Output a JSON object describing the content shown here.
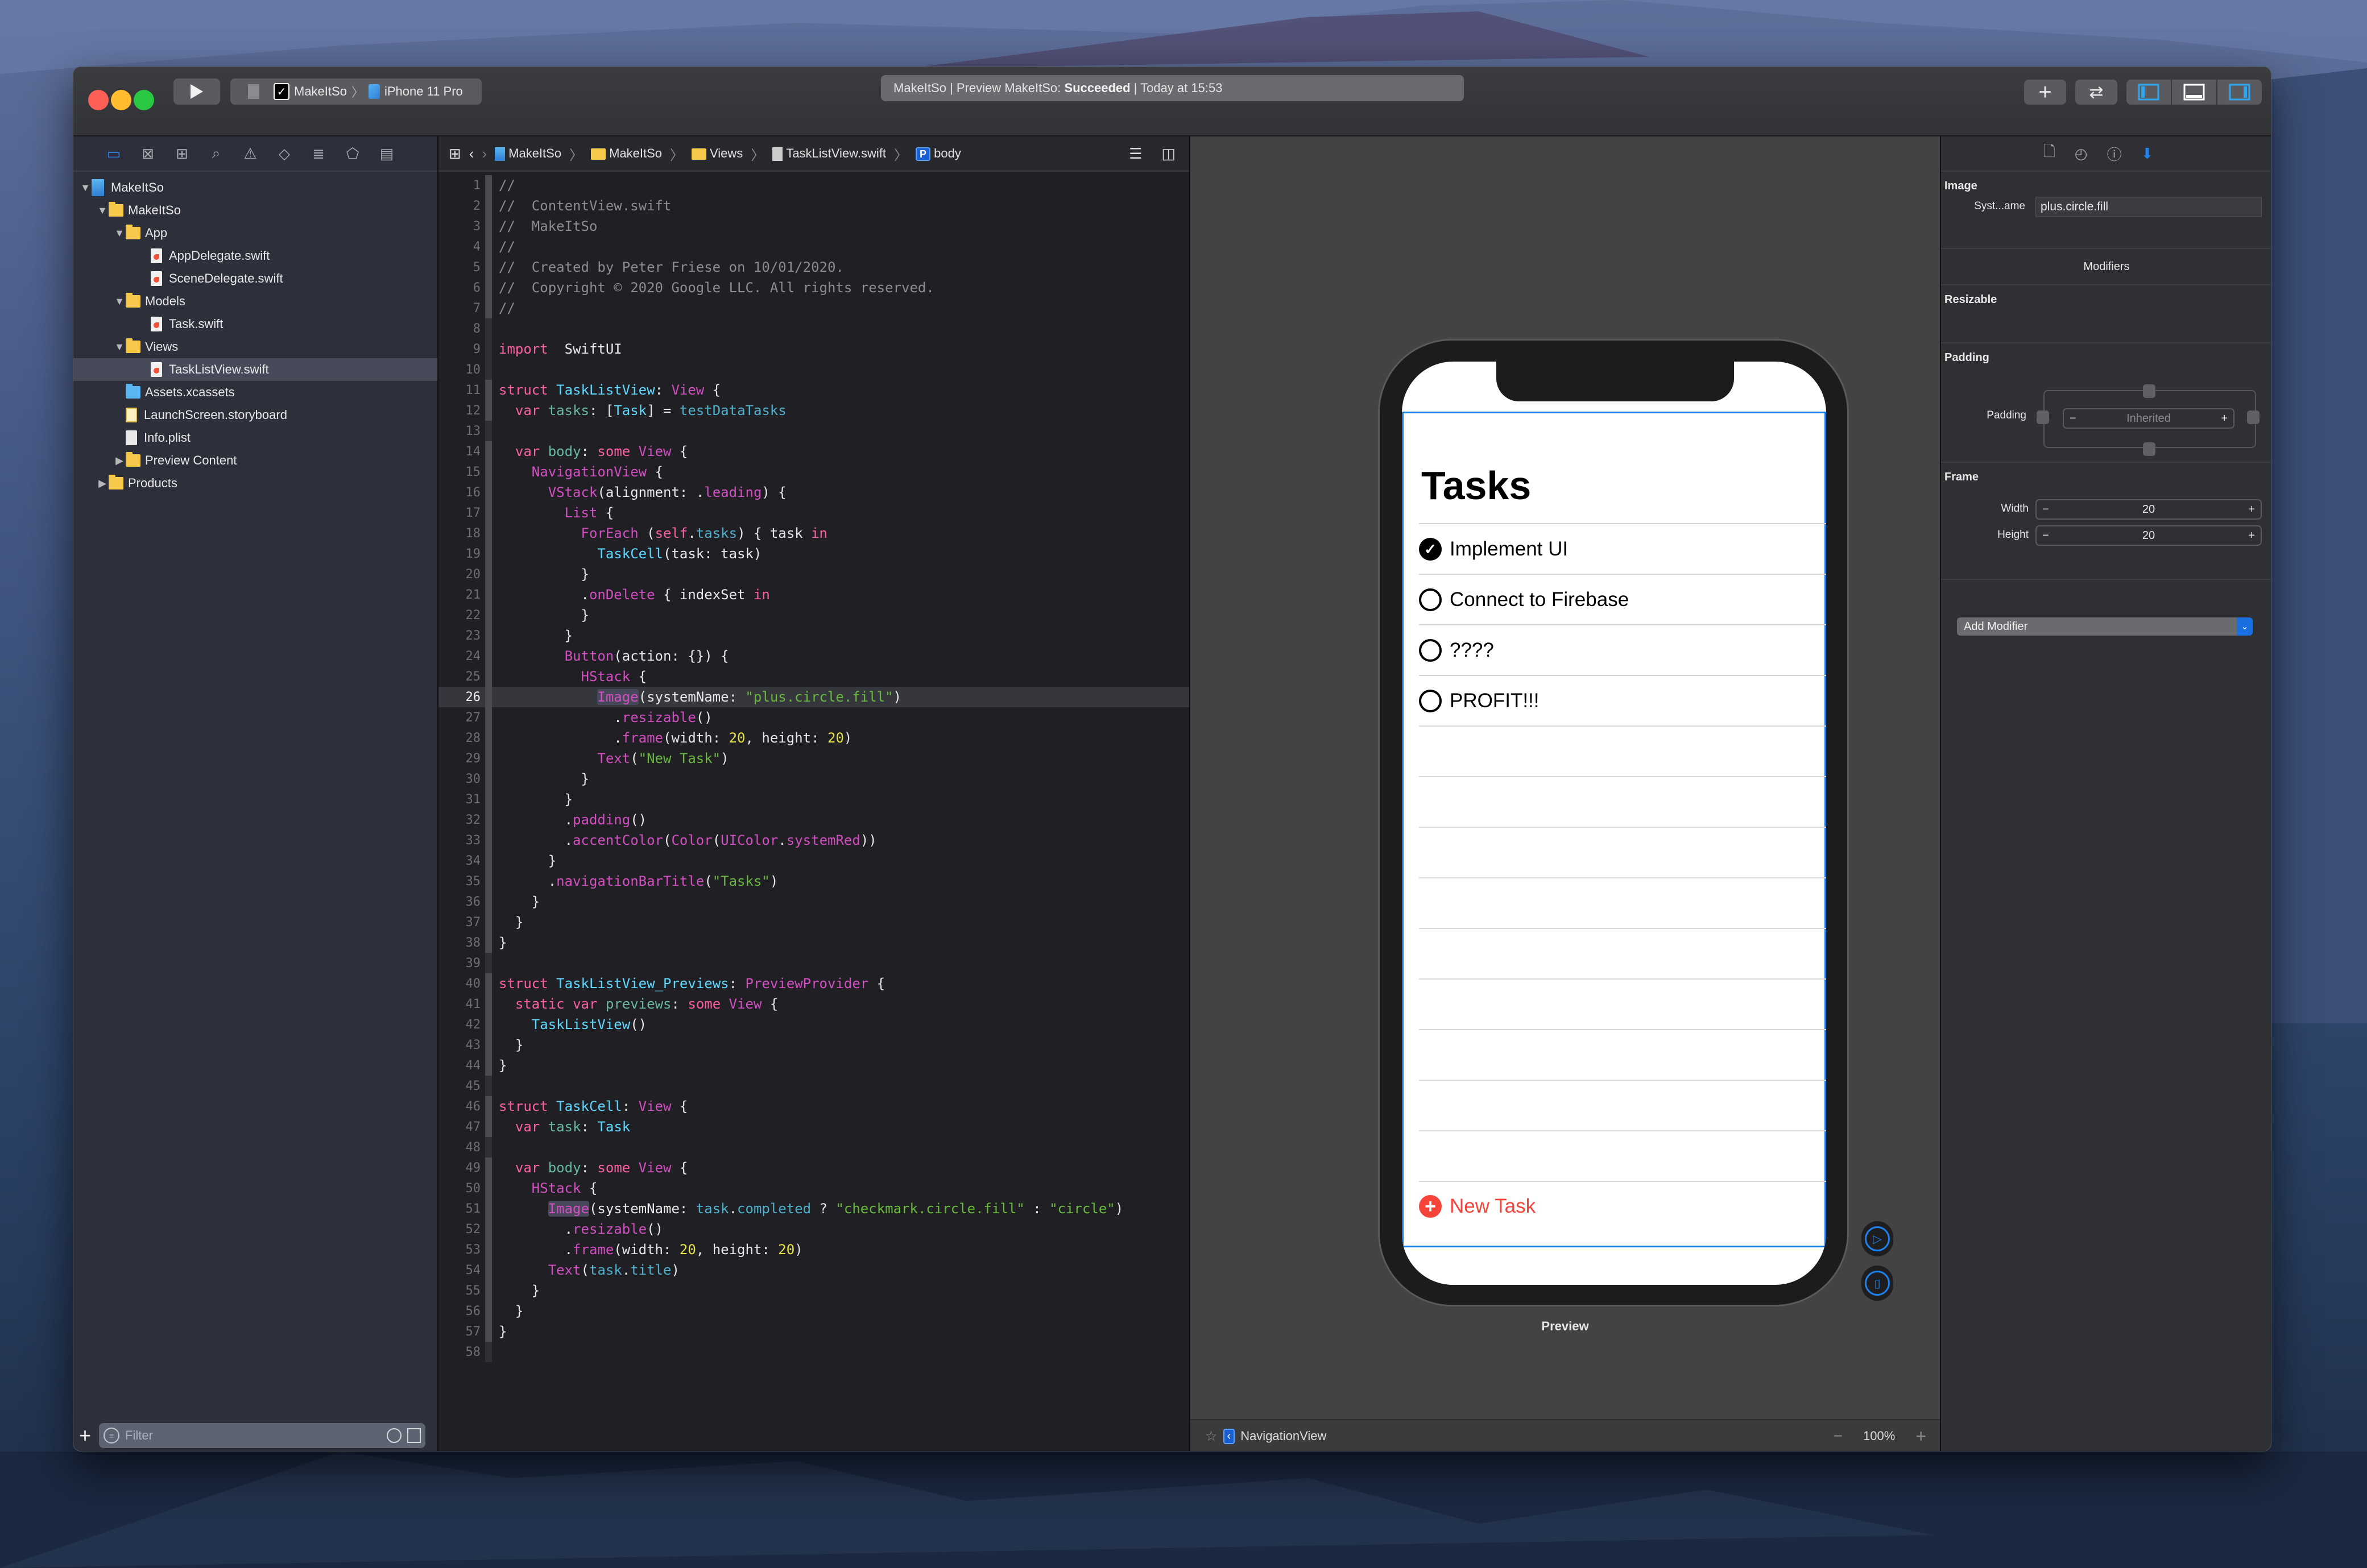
{
  "toolbar": {
    "scheme_target": "MakeItSo",
    "scheme_device": "iPhone 11 Pro",
    "activity_prefix": "MakeItSo | Preview MakeItSo: ",
    "activity_status": "Succeeded",
    "activity_suffix": " | Today at 15:53"
  },
  "navigator": {
    "tabs": [
      "project-navigator",
      "source-control-navigator",
      "symbol-navigator",
      "find-navigator",
      "issue-navigator",
      "test-navigator",
      "debug-navigator",
      "breakpoint-navigator",
      "report-navigator"
    ],
    "tree": [
      {
        "label": "MakeItSo",
        "kind": "project",
        "depth": 0,
        "disclosure": "open"
      },
      {
        "label": "MakeItSo",
        "kind": "folder",
        "depth": 1,
        "disclosure": "open"
      },
      {
        "label": "App",
        "kind": "folder",
        "depth": 2,
        "disclosure": "open"
      },
      {
        "label": "AppDelegate.swift",
        "kind": "swift",
        "depth": 3,
        "disclosure": "none"
      },
      {
        "label": "SceneDelegate.swift",
        "kind": "swift",
        "depth": 3,
        "disclosure": "none"
      },
      {
        "label": "Models",
        "kind": "folder",
        "depth": 2,
        "disclosure": "open"
      },
      {
        "label": "Task.swift",
        "kind": "swift",
        "depth": 3,
        "disclosure": "none"
      },
      {
        "label": "Views",
        "kind": "folder",
        "depth": 2,
        "disclosure": "open"
      },
      {
        "label": "TaskListView.swift",
        "kind": "swift",
        "depth": 3,
        "disclosure": "none",
        "selected": true
      },
      {
        "label": "Assets.xcassets",
        "kind": "assets",
        "depth": 2,
        "disclosure": "none"
      },
      {
        "label": "LaunchScreen.storyboard",
        "kind": "storyboard",
        "depth": 2,
        "disclosure": "none"
      },
      {
        "label": "Info.plist",
        "kind": "plist",
        "depth": 2,
        "disclosure": "none"
      },
      {
        "label": "Preview Content",
        "kind": "folder",
        "depth": 2,
        "disclosure": "closed"
      },
      {
        "label": "Products",
        "kind": "folder",
        "depth": 1,
        "disclosure": "closed"
      }
    ],
    "filter_placeholder": "Filter"
  },
  "jumpbar": {
    "crumbs": [
      "MakeItSo",
      "MakeItSo",
      "Views",
      "TaskListView.swift",
      "body"
    ]
  },
  "editor": {
    "current_line": 26,
    "lines": [
      [
        [
          "c-com",
          "//"
        ]
      ],
      [
        [
          "c-com",
          "//  ContentView.swift"
        ]
      ],
      [
        [
          "c-com",
          "//  MakeItSo"
        ]
      ],
      [
        [
          "c-com",
          "//"
        ]
      ],
      [
        [
          "c-com",
          "//  Created by Peter Friese on 10/01/2020."
        ]
      ],
      [
        [
          "c-com",
          "//  Copyright © 2020 Google LLC. All rights reserved."
        ]
      ],
      [
        [
          "c-com",
          "//"
        ]
      ],
      [],
      [
        [
          "c-kw",
          "import"
        ],
        [
          "",
          "  SwiftUI"
        ]
      ],
      [],
      [
        [
          "c-kw",
          "struct"
        ],
        [
          "",
          " "
        ],
        [
          "c-type",
          "TaskListView"
        ],
        [
          "",
          ": "
        ],
        [
          "c-fn",
          "View"
        ],
        [
          "",
          " {"
        ]
      ],
      [
        [
          "",
          "  "
        ],
        [
          "c-kw",
          "var"
        ],
        [
          "",
          " "
        ],
        [
          "c-prop",
          "tasks"
        ],
        [
          "",
          ": ["
        ],
        [
          "c-type",
          "Task"
        ],
        [
          "",
          "] = "
        ],
        [
          "c-proj",
          "testDataTasks"
        ]
      ],
      [],
      [
        [
          "",
          "  "
        ],
        [
          "c-kw",
          "var"
        ],
        [
          "",
          " "
        ],
        [
          "c-prop",
          "body"
        ],
        [
          "",
          ": "
        ],
        [
          "c-kw",
          "some"
        ],
        [
          "",
          " "
        ],
        [
          "c-fn",
          "View"
        ],
        [
          "",
          " {"
        ]
      ],
      [
        [
          "",
          "    "
        ],
        [
          "c-fn",
          "NavigationView"
        ],
        [
          "",
          " {"
        ]
      ],
      [
        [
          "",
          "      "
        ],
        [
          "c-fn",
          "VStack"
        ],
        [
          "",
          "(alignment: ."
        ],
        [
          "c-fn",
          "leading"
        ],
        [
          "",
          ") {"
        ]
      ],
      [
        [
          "",
          "        "
        ],
        [
          "c-fn",
          "List"
        ],
        [
          "",
          " {"
        ]
      ],
      [
        [
          "",
          "          "
        ],
        [
          "c-fn",
          "ForEach"
        ],
        [
          "",
          " ("
        ],
        [
          "c-kw",
          "self"
        ],
        [
          "",
          "."
        ],
        [
          "c-proj",
          "tasks"
        ],
        [
          "",
          ") { task "
        ],
        [
          "c-kw",
          "in"
        ]
      ],
      [
        [
          "",
          "            "
        ],
        [
          "c-type",
          "TaskCell"
        ],
        [
          "",
          "(task: task)"
        ]
      ],
      [
        [
          "",
          "          }"
        ]
      ],
      [
        [
          "",
          "          ."
        ],
        [
          "c-fn",
          "onDelete"
        ],
        [
          "",
          " { indexSet "
        ],
        [
          "c-kw",
          "in"
        ]
      ],
      [
        [
          "",
          "          }"
        ]
      ],
      [
        [
          "",
          "        }"
        ]
      ],
      [
        [
          "",
          "        "
        ],
        [
          "c-fn",
          "Button"
        ],
        [
          "",
          "(action: {}) {"
        ]
      ],
      [
        [
          "",
          "          "
        ],
        [
          "c-fn",
          "HStack"
        ],
        [
          "",
          " {"
        ]
      ],
      [
        [
          "",
          "            "
        ],
        [
          "c-fn c-hl",
          "Image"
        ],
        [
          "",
          "(systemName: "
        ],
        [
          "c-str",
          "\"plus.circle.fill\""
        ],
        [
          "",
          ")"
        ]
      ],
      [
        [
          "",
          "              ."
        ],
        [
          "c-fn",
          "resizable"
        ],
        [
          "",
          "()"
        ]
      ],
      [
        [
          "",
          "              ."
        ],
        [
          "c-fn",
          "frame"
        ],
        [
          "",
          "(width: "
        ],
        [
          "c-num",
          "20"
        ],
        [
          "",
          ", height: "
        ],
        [
          "c-num",
          "20"
        ],
        [
          "",
          ")"
        ]
      ],
      [
        [
          "",
          "            "
        ],
        [
          "c-fn",
          "Text"
        ],
        [
          "",
          "("
        ],
        [
          "c-str",
          "\"New Task\""
        ],
        [
          "",
          ")"
        ]
      ],
      [
        [
          "",
          "          }"
        ]
      ],
      [
        [
          "",
          "        }"
        ]
      ],
      [
        [
          "",
          "        ."
        ],
        [
          "c-fn",
          "padding"
        ],
        [
          "",
          "()"
        ]
      ],
      [
        [
          "",
          "        ."
        ],
        [
          "c-fn",
          "accentColor"
        ],
        [
          "",
          "("
        ],
        [
          "c-fn",
          "Color"
        ],
        [
          "",
          "("
        ],
        [
          "c-fn",
          "UIColor"
        ],
        [
          "",
          "."
        ],
        [
          "c-fn",
          "systemRed"
        ],
        [
          "",
          "))"
        ]
      ],
      [
        [
          "",
          "      }"
        ]
      ],
      [
        [
          "",
          "      ."
        ],
        [
          "c-fn",
          "navigationBarTitle"
        ],
        [
          "",
          "("
        ],
        [
          "c-str",
          "\"Tasks\""
        ],
        [
          "",
          ")"
        ]
      ],
      [
        [
          "",
          "    }"
        ]
      ],
      [
        [
          "",
          "  }"
        ]
      ],
      [
        [
          "",
          "}"
        ]
      ],
      [],
      [
        [
          "c-kw",
          "struct"
        ],
        [
          "",
          " "
        ],
        [
          "c-type",
          "TaskListView_Previews"
        ],
        [
          "",
          ": "
        ],
        [
          "c-fn",
          "PreviewProvider"
        ],
        [
          "",
          " {"
        ]
      ],
      [
        [
          "",
          "  "
        ],
        [
          "c-kw",
          "static"
        ],
        [
          "",
          " "
        ],
        [
          "c-kw",
          "var"
        ],
        [
          "",
          " "
        ],
        [
          "c-prop",
          "previews"
        ],
        [
          "",
          ": "
        ],
        [
          "c-kw",
          "some"
        ],
        [
          "",
          " "
        ],
        [
          "c-fn",
          "View"
        ],
        [
          "",
          " {"
        ]
      ],
      [
        [
          "",
          "    "
        ],
        [
          "c-type",
          "TaskListView"
        ],
        [
          "",
          "()"
        ]
      ],
      [
        [
          "",
          "  }"
        ]
      ],
      [
        [
          "",
          "}"
        ]
      ],
      [],
      [
        [
          "c-kw",
          "struct"
        ],
        [
          "",
          " "
        ],
        [
          "c-type",
          "TaskCell"
        ],
        [
          "",
          ": "
        ],
        [
          "c-fn",
          "View"
        ],
        [
          "",
          " {"
        ]
      ],
      [
        [
          "",
          "  "
        ],
        [
          "c-kw",
          "var"
        ],
        [
          "",
          " "
        ],
        [
          "c-prop",
          "task"
        ],
        [
          "",
          ": "
        ],
        [
          "c-type",
          "Task"
        ]
      ],
      [],
      [
        [
          "",
          "  "
        ],
        [
          "c-kw",
          "var"
        ],
        [
          "",
          " "
        ],
        [
          "c-prop",
          "body"
        ],
        [
          "",
          ": "
        ],
        [
          "c-kw",
          "some"
        ],
        [
          "",
          " "
        ],
        [
          "c-fn",
          "View"
        ],
        [
          "",
          " {"
        ]
      ],
      [
        [
          "",
          "    "
        ],
        [
          "c-fn",
          "HStack"
        ],
        [
          "",
          " {"
        ]
      ],
      [
        [
          "",
          "      "
        ],
        [
          "c-fn c-hl",
          "Image"
        ],
        [
          "",
          "(systemName: "
        ],
        [
          "c-proj",
          "task"
        ],
        [
          "",
          "."
        ],
        [
          "c-proj",
          "completed"
        ],
        [
          "",
          " ? "
        ],
        [
          "c-str",
          "\"checkmark.circle.fill\""
        ],
        [
          "",
          " : "
        ],
        [
          "c-str",
          "\"circle\""
        ],
        [
          "",
          ")"
        ]
      ],
      [
        [
          "",
          "        ."
        ],
        [
          "c-fn",
          "resizable"
        ],
        [
          "",
          "()"
        ]
      ],
      [
        [
          "",
          "        ."
        ],
        [
          "c-fn",
          "frame"
        ],
        [
          "",
          "(width: "
        ],
        [
          "c-num",
          "20"
        ],
        [
          "",
          ", height: "
        ],
        [
          "c-num",
          "20"
        ],
        [
          "",
          ")"
        ]
      ],
      [
        [
          "",
          "      "
        ],
        [
          "c-fn",
          "Text"
        ],
        [
          "",
          "("
        ],
        [
          "c-proj",
          "task"
        ],
        [
          "",
          "."
        ],
        [
          "c-proj",
          "title"
        ],
        [
          "",
          ")"
        ]
      ],
      [
        [
          "",
          "    }"
        ]
      ],
      [
        [
          "",
          "  }"
        ]
      ],
      [
        [
          "",
          "}"
        ]
      ],
      []
    ]
  },
  "preview": {
    "nav_title": "Tasks",
    "tasks": [
      {
        "title": "Implement UI",
        "completed": true
      },
      {
        "title": "Connect to Firebase",
        "completed": false
      },
      {
        "title": "????",
        "completed": false
      },
      {
        "title": "PROFIT!!!",
        "completed": false
      }
    ],
    "new_task_label": "New Task",
    "accent_color": "#f5453b",
    "label": "Preview",
    "bottom_breadcrumb": "NavigationView",
    "zoom_level": "100%"
  },
  "inspector": {
    "image_section": "Image",
    "system_name_label": "Syst...ame",
    "system_name_value": "plus.circle.fill",
    "modifiers_title": "Modifiers",
    "resizable_section": "Resizable",
    "padding_section": "Padding",
    "padding_label": "Padding",
    "padding_value": "Inherited",
    "frame_section": "Frame",
    "width_label": "Width",
    "width_value": "20",
    "height_label": "Height",
    "height_value": "20",
    "add_modifier_label": "Add Modifier"
  }
}
